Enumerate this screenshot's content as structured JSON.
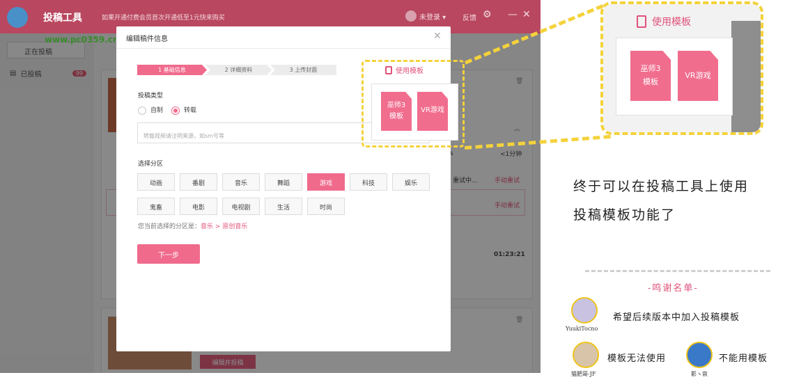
{
  "app": {
    "title": "投稿工具",
    "promo": "如果开通付费会员首次开通低至1元快来购买",
    "login": "未登录 ▾",
    "feedback": "反馈",
    "watermark": "www.pc0359.cn",
    "uploading": "正在投稿",
    "published": "已投稿",
    "published_count": "99",
    "bg_texts": {
      "time1": "<1分钟",
      "status1": "重试中...",
      "retry1": "手动重试",
      "retry2": "手动重试",
      "duration": "01:23:21",
      "suffix1": "s",
      "edit_submit": "编辑并投稿"
    }
  },
  "dialog": {
    "title": "编辑稿件信息",
    "steps": [
      "1 基础信息",
      "2 详细资料",
      "3 上传封面"
    ],
    "type_label": "投稿类型",
    "radio_self": "自制",
    "radio_repost": "转载",
    "source_placeholder": "转载视频请注明来源，如sm号等",
    "category_label": "选择分区",
    "categories_row1": [
      "动画",
      "番剧",
      "音乐",
      "舞蹈",
      "游戏",
      "科技",
      "娱乐"
    ],
    "categories_row2": [
      "鬼畜",
      "电影",
      "电视剧",
      "生活",
      "时尚"
    ],
    "selected_category": "游戏",
    "current_prefix": "您当前选择的分区是：",
    "current_main": "音乐",
    "current_sep": ">",
    "current_sub": "原创音乐",
    "next_button": "下一步"
  },
  "template_popover": {
    "label": "使用模板",
    "card1": [
      "巫师3",
      "模板"
    ],
    "card2": "VR游戏"
  },
  "annotation": {
    "line1": "终于可以在投稿工具上使用",
    "line2": "投稿模板功能了",
    "credits_title": "-鸣谢名单-",
    "credits": [
      {
        "name": "YuukiTocno",
        "msg": "希望后续版本中加入投稿模板"
      },
      {
        "name": "猫肥哥-JF",
        "msg": "模板无法使用"
      },
      {
        "name": "影ヽ哀",
        "msg": "不能用模板"
      }
    ]
  },
  "colors": {
    "accent": "#f06a8c",
    "titlebar": "#b8475f",
    "highlight": "#f4d23b"
  }
}
